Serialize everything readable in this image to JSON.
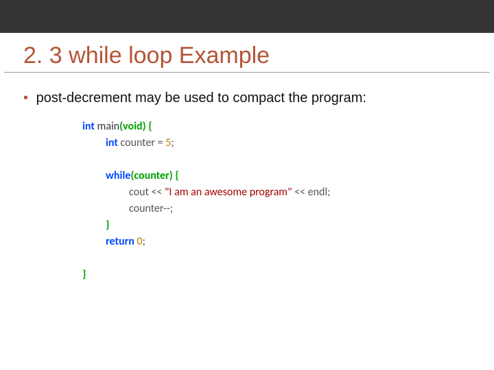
{
  "title": "2. 3 while loop  Example",
  "bullet": "post-decrement may be used to compact the program:",
  "code": {
    "l1_kw": "int",
    "l1_fn": " main",
    "l1_par": "(void)",
    "l1_br": " {",
    "l2_kw": "int",
    "l2_rest": " counter = ",
    "l2_num": "5",
    "l2_semi": ";",
    "l4_kw": "while",
    "l4_par": "(counter)",
    "l4_br": " {",
    "l5_a": "cout << ",
    "l5_str": "\"I am an awesome program\"",
    "l5_b": " << endl;",
    "l6": "counter--;",
    "l7_br": "}",
    "l8_kw": "return",
    "l8_rest": " ",
    "l8_num": "0",
    "l8_semi": ";",
    "l10_br": "}"
  }
}
